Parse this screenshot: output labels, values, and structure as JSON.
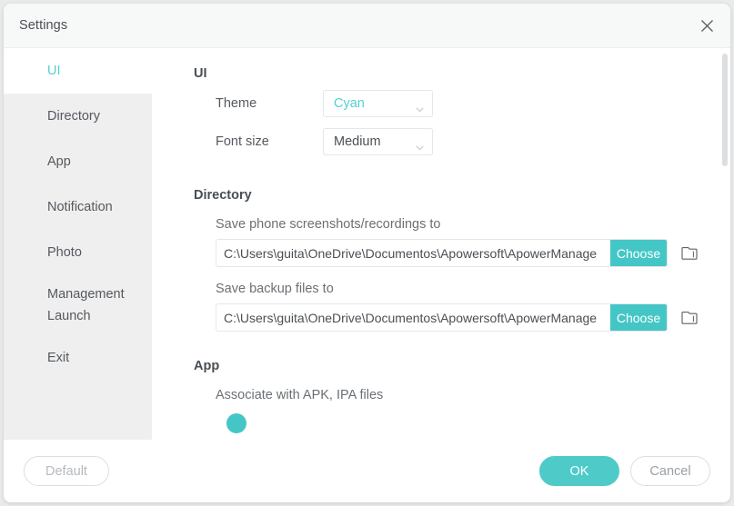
{
  "window": {
    "title": "Settings",
    "close_icon": "close-icon"
  },
  "sidebar": {
    "items": [
      {
        "label": "UI",
        "active": true
      },
      {
        "label": "Directory",
        "active": false
      },
      {
        "label": "App",
        "active": false
      },
      {
        "label": "Notification",
        "active": false
      },
      {
        "label": "Photo",
        "active": false
      },
      {
        "label": "Management Launch",
        "active": false
      },
      {
        "label": "Exit",
        "active": false
      }
    ]
  },
  "content": {
    "ui_section": {
      "title": "UI",
      "theme": {
        "label": "Theme",
        "value": "Cyan",
        "chevron_icon": "chevron-down-icon"
      },
      "font_size": {
        "label": "Font size",
        "value": "Medium",
        "chevron_icon": "chevron-down-icon"
      }
    },
    "directory_section": {
      "title": "Directory",
      "screenshots": {
        "label": "Save phone screenshots/recordings to",
        "path": "C:\\Users\\guita\\OneDrive\\Documentos\\Apowersoft\\ApowerManage",
        "choose_label": "Choose",
        "folder_icon": "folder-icon"
      },
      "backup": {
        "label": "Save backup files to",
        "path": "C:\\Users\\guita\\OneDrive\\Documentos\\Apowersoft\\ApowerManage",
        "choose_label": "Choose",
        "folder_icon": "folder-icon"
      }
    },
    "app_section": {
      "title": "App",
      "associate_label": "Associate with APK, IPA files"
    }
  },
  "footer": {
    "default_label": "Default",
    "ok_label": "OK",
    "cancel_label": "Cancel"
  },
  "colors": {
    "accent": "#4ecac9",
    "choose_button": "#45c6c6",
    "active_nav_text": "#53cfcf",
    "sidebar_bg": "#efefef",
    "titlebar_bg": "#f7f8f8"
  }
}
